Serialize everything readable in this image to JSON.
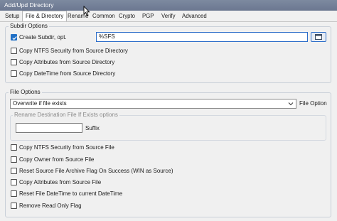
{
  "window": {
    "title": "Add/Upd Directory"
  },
  "tabs": [
    "Setup",
    "File & Directory",
    "Rename",
    "Common",
    "Crypto",
    "PGP",
    "Verify",
    "Advanced"
  ],
  "subdir_options": {
    "legend": "Subdir Options",
    "create_subdir": {
      "label": "Create Subdir, opt.",
      "checked": true,
      "value": "%SFS"
    },
    "items": [
      {
        "label": "Copy NTFS Security from Source Directory",
        "checked": false
      },
      {
        "label": "Copy Attributes from Source Directory",
        "checked": false
      },
      {
        "label": "Copy DateTime from Source Directory",
        "checked": false
      }
    ]
  },
  "file_options": {
    "legend": "File Options",
    "file_option_select": {
      "value": "Overwrite if file exists",
      "label": "File Option"
    },
    "rename_group": {
      "legend": "Rename Destination File If Exists options",
      "suffix_label": "Suffix",
      "suffix_value": ""
    },
    "items": [
      {
        "label": "Copy NTFS Security from Source File",
        "checked": false
      },
      {
        "label": "Copy Owner from Source File",
        "checked": false
      },
      {
        "label": "Reset Source File Archive Flag On Success (WIN as Source)",
        "checked": false
      },
      {
        "label": "Copy Attributes from Source File",
        "checked": false
      },
      {
        "label": "Reset File DateTime to current DateTime",
        "checked": false
      },
      {
        "label": "Remove Read Only Flag",
        "checked": false
      }
    ]
  },
  "colors": {
    "accent": "#1f6fc5",
    "titlebar": "#6b7790",
    "background": "#f0f0f0"
  }
}
